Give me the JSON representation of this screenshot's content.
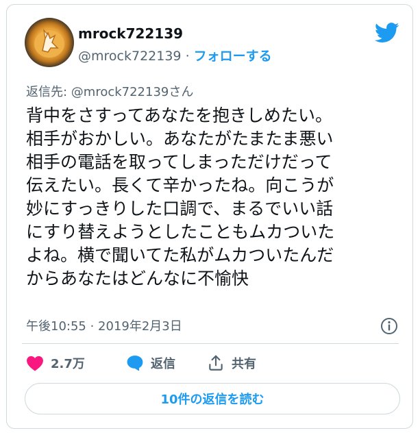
{
  "user": {
    "display_name": "mrock722139",
    "handle": "@mrock722139",
    "separator": "·",
    "follow_label": "フォローする"
  },
  "reply_to": "返信先: @mrock722139さん",
  "tweet_text": "背中をさすってあなたを抱きしめたい。\n相手がおかしい。あなたがたまたま悪い\n相手の電話を取ってしまっただけだって\n伝えたい。長くて辛かったね。向こうが\n妙にすっきりした口調で、まるでいい話\nにすり替えようとしたこともムカついた\nよね。横で聞いてた私がムカついたんだ\nからあなたはどんなに不愉快",
  "timestamp": "午後10:55 · 2019年2月3日",
  "actions": {
    "like_count": "2.7万",
    "reply_label": "返信",
    "share_label": "共有"
  },
  "read_replies_label": "10件の返信を読む",
  "colors": {
    "brand_blue": "#1d9bf0",
    "like_pink": "#f91880",
    "text_secondary": "#536471",
    "border": "#cfd9de"
  },
  "icons": {
    "brand": "twitter-bird-icon",
    "info": "info-icon",
    "like": "heart-icon",
    "reply": "speech-bubble-icon",
    "share": "share-upload-icon"
  }
}
